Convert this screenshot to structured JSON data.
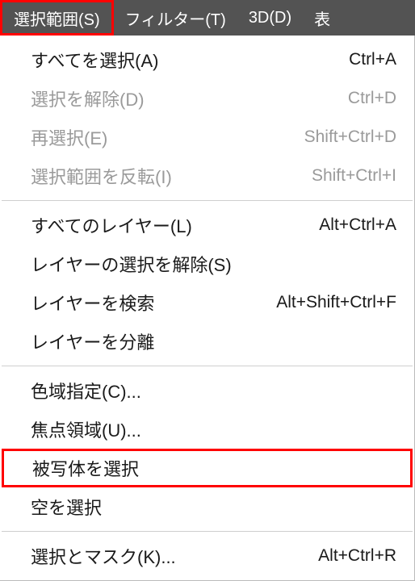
{
  "menubar": {
    "items": [
      {
        "label": "選択範囲(S)"
      },
      {
        "label": "フィルター(T)"
      },
      {
        "label": "3D(D)"
      },
      {
        "label": "表"
      }
    ]
  },
  "dropdown": {
    "groups": [
      [
        {
          "label": "すべてを選択(A)",
          "shortcut": "Ctrl+A",
          "disabled": false
        },
        {
          "label": "選択を解除(D)",
          "shortcut": "Ctrl+D",
          "disabled": true
        },
        {
          "label": "再選択(E)",
          "shortcut": "Shift+Ctrl+D",
          "disabled": true
        },
        {
          "label": "選択範囲を反転(I)",
          "shortcut": "Shift+Ctrl+I",
          "disabled": true
        }
      ],
      [
        {
          "label": "すべてのレイヤー(L)",
          "shortcut": "Alt+Ctrl+A",
          "disabled": false
        },
        {
          "label": "レイヤーの選択を解除(S)",
          "shortcut": "",
          "disabled": false
        },
        {
          "label": "レイヤーを検索",
          "shortcut": "Alt+Shift+Ctrl+F",
          "disabled": false
        },
        {
          "label": "レイヤーを分離",
          "shortcut": "",
          "disabled": false
        }
      ],
      [
        {
          "label": "色域指定(C)...",
          "shortcut": "",
          "disabled": false
        },
        {
          "label": "焦点領域(U)...",
          "shortcut": "",
          "disabled": false
        },
        {
          "label": "被写体を選択",
          "shortcut": "",
          "disabled": false,
          "highlighted": true
        },
        {
          "label": "空を選択",
          "shortcut": "",
          "disabled": false
        }
      ],
      [
        {
          "label": "選択とマスク(K)...",
          "shortcut": "Alt+Ctrl+R",
          "disabled": false
        }
      ]
    ]
  }
}
